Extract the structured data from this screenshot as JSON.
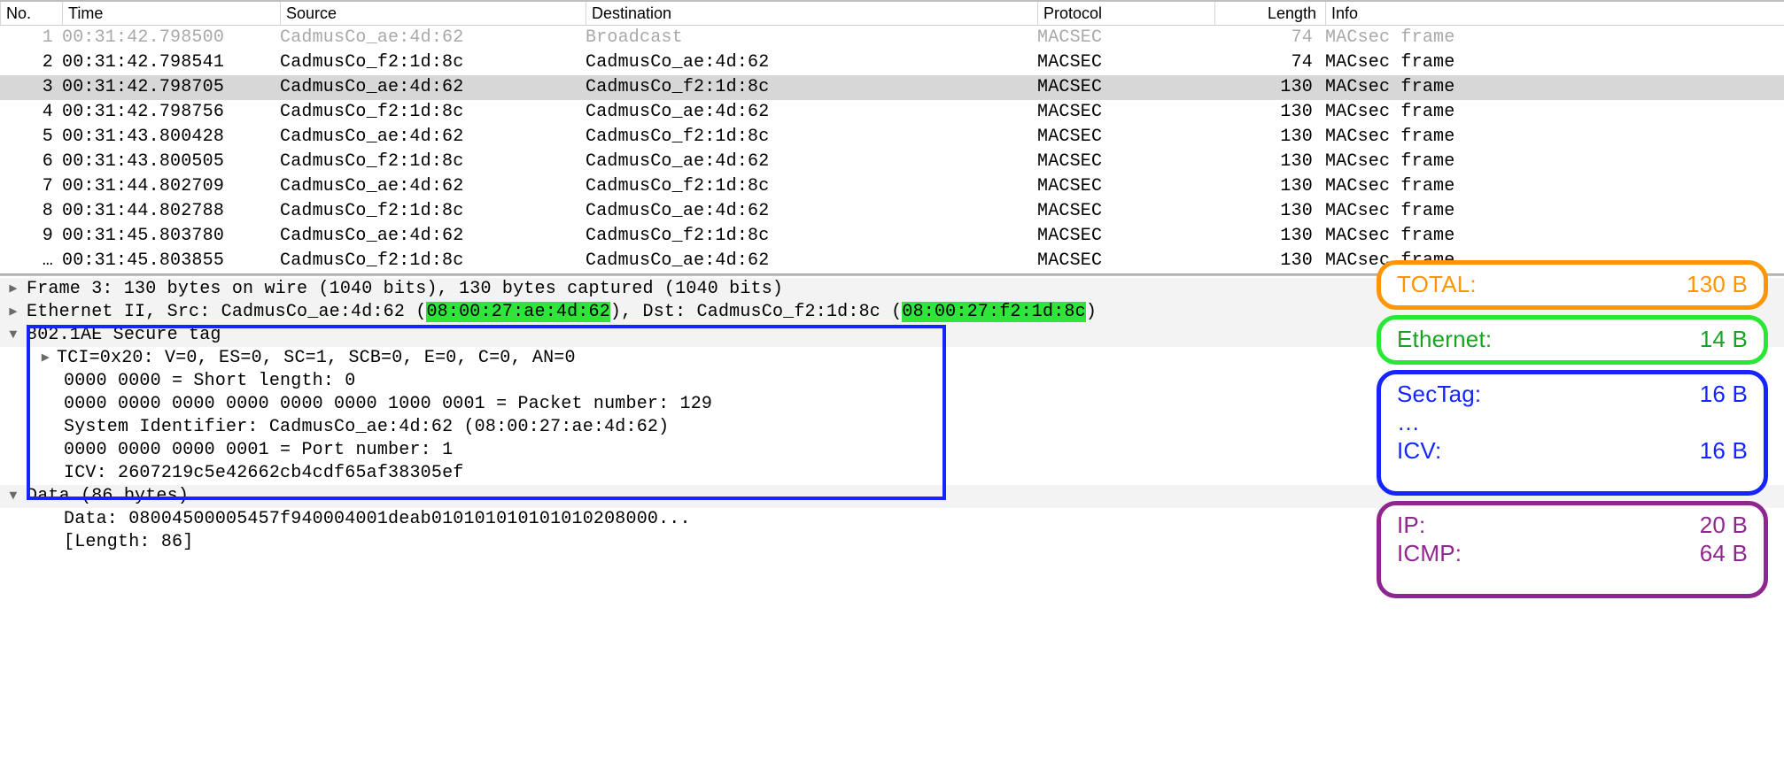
{
  "columns": {
    "no": "No.",
    "time": "Time",
    "src": "Source",
    "dst": "Destination",
    "proto": "Protocol",
    "len": "Length",
    "info": "Info"
  },
  "packets": [
    {
      "no": "1",
      "time": "00:31:42.798500",
      "src": "CadmusCo_ae:4d:62",
      "dst": "Broadcast",
      "proto": "MACSEC",
      "len": "74",
      "info": "MACsec frame",
      "gray": true,
      "sel": false
    },
    {
      "no": "2",
      "time": "00:31:42.798541",
      "src": "CadmusCo_f2:1d:8c",
      "dst": "CadmusCo_ae:4d:62",
      "proto": "MACSEC",
      "len": "74",
      "info": "MACsec frame",
      "gray": false,
      "sel": false
    },
    {
      "no": "3",
      "time": "00:31:42.798705",
      "src": "CadmusCo_ae:4d:62",
      "dst": "CadmusCo_f2:1d:8c",
      "proto": "MACSEC",
      "len": "130",
      "info": "MACsec frame",
      "gray": false,
      "sel": true
    },
    {
      "no": "4",
      "time": "00:31:42.798756",
      "src": "CadmusCo_f2:1d:8c",
      "dst": "CadmusCo_ae:4d:62",
      "proto": "MACSEC",
      "len": "130",
      "info": "MACsec frame",
      "gray": false,
      "sel": false
    },
    {
      "no": "5",
      "time": "00:31:43.800428",
      "src": "CadmusCo_ae:4d:62",
      "dst": "CadmusCo_f2:1d:8c",
      "proto": "MACSEC",
      "len": "130",
      "info": "MACsec frame",
      "gray": false,
      "sel": false
    },
    {
      "no": "6",
      "time": "00:31:43.800505",
      "src": "CadmusCo_f2:1d:8c",
      "dst": "CadmusCo_ae:4d:62",
      "proto": "MACSEC",
      "len": "130",
      "info": "MACsec frame",
      "gray": false,
      "sel": false
    },
    {
      "no": "7",
      "time": "00:31:44.802709",
      "src": "CadmusCo_ae:4d:62",
      "dst": "CadmusCo_f2:1d:8c",
      "proto": "MACSEC",
      "len": "130",
      "info": "MACsec frame",
      "gray": false,
      "sel": false
    },
    {
      "no": "8",
      "time": "00:31:44.802788",
      "src": "CadmusCo_f2:1d:8c",
      "dst": "CadmusCo_ae:4d:62",
      "proto": "MACSEC",
      "len": "130",
      "info": "MACsec frame",
      "gray": false,
      "sel": false
    },
    {
      "no": "9",
      "time": "00:31:45.803780",
      "src": "CadmusCo_ae:4d:62",
      "dst": "CadmusCo_f2:1d:8c",
      "proto": "MACSEC",
      "len": "130",
      "info": "MACsec frame",
      "gray": false,
      "sel": false
    },
    {
      "no": "…",
      "time": "00:31:45.803855",
      "src": "CadmusCo_f2:1d:8c",
      "dst": "CadmusCo_ae:4d:62",
      "proto": "MACSEC",
      "len": "130",
      "info": "MACsec frame",
      "gray": false,
      "sel": false
    }
  ],
  "detail": {
    "frame": "Frame 3: 130 bytes on wire (1040 bits), 130 bytes captured (1040 bits)",
    "eth_a": "Ethernet II, Src: CadmusCo_ae:4d:62 (",
    "eth_mac1": "08:00:27:ae:4d:62",
    "eth_b": "), Dst: CadmusCo_f2:1d:8c (",
    "eth_mac2": "08:00:27:f2:1d:8c",
    "eth_c": ")",
    "sectag": "802.1AE Secure tag",
    "tci": "TCI=0x20: V=0, ES=0, SC=1, SCB=0, E=0, C=0, AN=0",
    "sl": "0000 0000 = Short length: 0",
    "pn": "0000 0000 0000 0000 0000 0000 1000 0001 = Packet number: 129",
    "sysid": "System Identifier: CadmusCo_ae:4d:62 (08:00:27:ae:4d:62)",
    "port": "0000 0000 0000 0001 = Port number: 1",
    "icv": "ICV: 2607219c5e42662cb4cdf65af38305ef",
    "data_hdr": "Data (86 bytes)",
    "data_hex": "Data: 08004500005457f940004001deab010101010101010208000...",
    "data_len": "[Length: 86]"
  },
  "cards": {
    "total": {
      "k": "TOTAL:",
      "v": "130 B"
    },
    "eth": {
      "k": "Ethernet:",
      "v": "14 B"
    },
    "sec1": {
      "k": "SecTag:",
      "v": "16 B"
    },
    "secdots": "…",
    "sec2": {
      "k": "ICV:",
      "v": "16 B"
    },
    "ip": {
      "k": "IP:",
      "v": "20 B"
    },
    "icmp": {
      "k": "ICMP:",
      "v": "64 B"
    }
  }
}
